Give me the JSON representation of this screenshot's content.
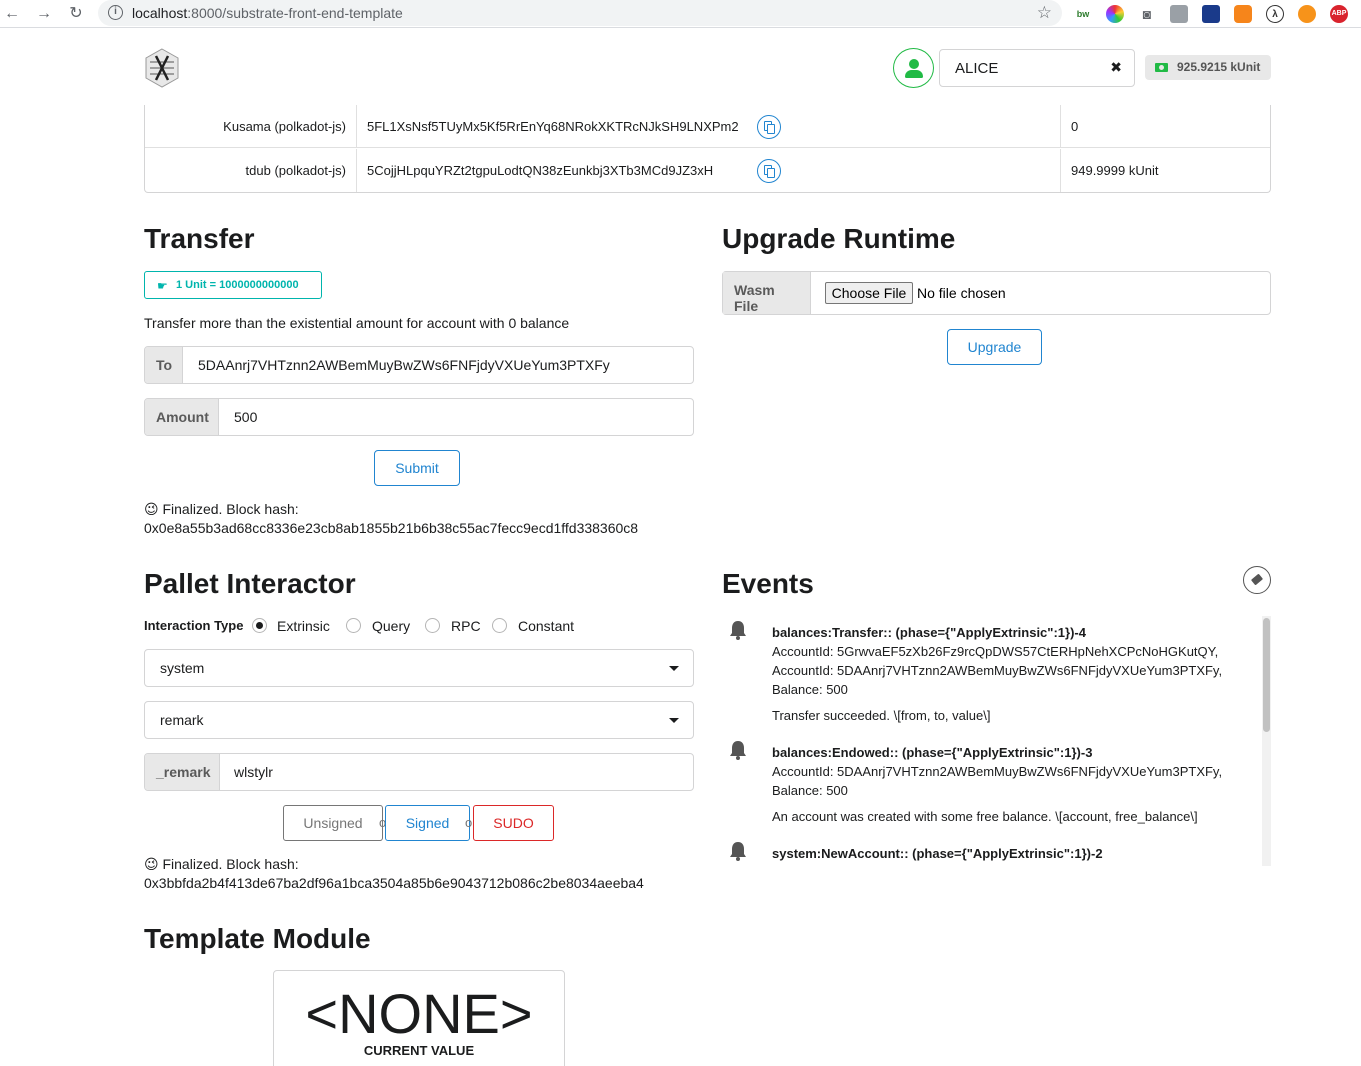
{
  "browser": {
    "url_host": "localhost",
    "url_path": ":8000/substrate-front-end-template",
    "ext_bw": "bw",
    "ext_abp": "ABP"
  },
  "header": {
    "account_name": "ALICE",
    "balance": "925.9215 kUnit"
  },
  "accounts": [
    {
      "name": "Kusama (polkadot-js)",
      "address": "5FL1XsNsf5TUyMx5Kf5RrEnYq68NRokXKTRcNJkSH9LNXPm2",
      "balance": "0"
    },
    {
      "name": "tdub (polkadot-js)",
      "address": "5CojjHLpquYRZt2tgpuLodtQN38zEunkbj3XTb3MCd9JZ3xH",
      "balance": "949.9999 kUnit"
    }
  ],
  "transfer": {
    "heading": "Transfer",
    "unit_label": "1 Unit = 1000000000000",
    "note": "Transfer more than the existential amount for account with 0 balance",
    "to_label": "To",
    "to_value": "5DAAnrj7VHTznn2AWBemMuyBwZWs6FNFjdyVXUeYum3PTXFy",
    "amount_label": "Amount",
    "amount_value": "500",
    "submit_label": "Submit",
    "status_line1": "😉 Finalized. Block hash:",
    "status_line2": "0x0e8a55b3ad68cc8336e23cb8ab1855b21b6b38c55ac7fecc9ecd1ffd338360c8"
  },
  "upgrade": {
    "heading": "Upgrade Runtime",
    "wasm_label": "Wasm File",
    "choose_file": "Choose File",
    "no_file": "No file chosen",
    "upgrade_label": "Upgrade"
  },
  "pallet": {
    "heading": "Pallet Interactor",
    "interaction_type_label": "Interaction Type",
    "options": [
      "Extrinsic",
      "Query",
      "RPC",
      "Constant"
    ],
    "selected_option": "Extrinsic",
    "pallet_value": "system",
    "callable_value": "remark",
    "param_label": "_remark",
    "param_value": "wlstylr",
    "unsigned_label": "Unsigned",
    "or1": "or",
    "signed_label": "Signed",
    "or2": "or",
    "sudo_label": "SUDO",
    "status_line1": "😉 Finalized. Block hash:",
    "status_line2": "0x3bbfda2b4f413de67ba2df96a1bca3504a85b6e9043712b086c2be8034aeeba4"
  },
  "events": {
    "heading": "Events",
    "items": [
      {
        "title": "balances:Transfer:: (phase={\"ApplyExtrinsic\":1})-4",
        "lines": [
          "AccountId: 5GrwvaEF5zXb26Fz9rcQpDWS57CtERHpNehXCPcNoHGKutQY,",
          "AccountId: 5DAAnrj7VHTznn2AWBemMuyBwZWs6FNFjdyVXUeYum3PTXFy,",
          "Balance: 500"
        ],
        "desc": "Transfer succeeded. \\[from, to, value\\]"
      },
      {
        "title": "balances:Endowed:: (phase={\"ApplyExtrinsic\":1})-3",
        "lines": [
          "AccountId: 5DAAnrj7VHTznn2AWBemMuyBwZWs6FNFjdyVXUeYum3PTXFy,",
          "Balance: 500"
        ],
        "desc": "An account was created with some free balance. \\[account, free_balance\\]"
      },
      {
        "title": "system:NewAccount:: (phase={\"ApplyExtrinsic\":1})-2",
        "lines": [],
        "desc": ""
      }
    ]
  },
  "template": {
    "heading": "Template Module",
    "value": "<NONE>",
    "value_label": "CURRENT VALUE"
  },
  "colors": {
    "primary_blue": "#2185d0",
    "teal": "#00b5ad",
    "green": "#21ba45",
    "red": "#db2828"
  }
}
